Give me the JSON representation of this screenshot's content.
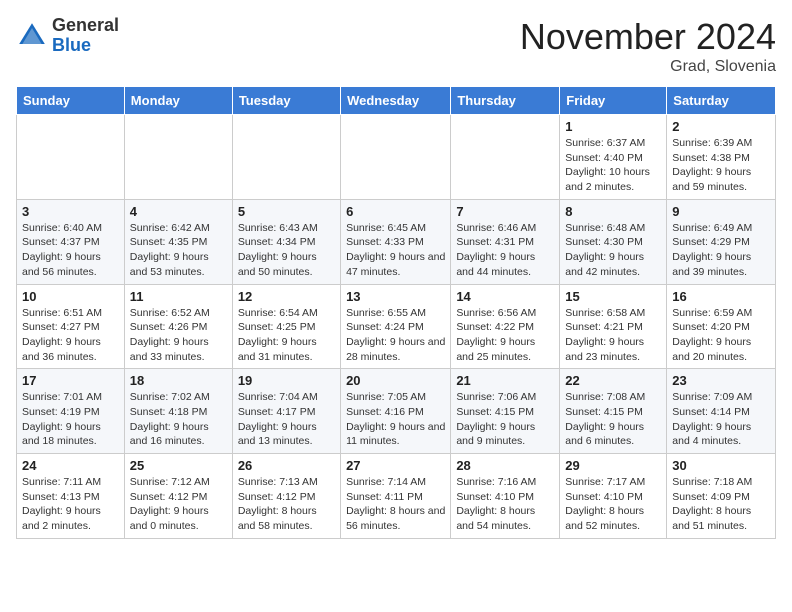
{
  "logo": {
    "general": "General",
    "blue": "Blue"
  },
  "title": "November 2024",
  "location": "Grad, Slovenia",
  "days_header": [
    "Sunday",
    "Monday",
    "Tuesday",
    "Wednesday",
    "Thursday",
    "Friday",
    "Saturday"
  ],
  "weeks": [
    [
      {
        "day": "",
        "info": ""
      },
      {
        "day": "",
        "info": ""
      },
      {
        "day": "",
        "info": ""
      },
      {
        "day": "",
        "info": ""
      },
      {
        "day": "",
        "info": ""
      },
      {
        "day": "1",
        "info": "Sunrise: 6:37 AM\nSunset: 4:40 PM\nDaylight: 10 hours and 2 minutes."
      },
      {
        "day": "2",
        "info": "Sunrise: 6:39 AM\nSunset: 4:38 PM\nDaylight: 9 hours and 59 minutes."
      }
    ],
    [
      {
        "day": "3",
        "info": "Sunrise: 6:40 AM\nSunset: 4:37 PM\nDaylight: 9 hours and 56 minutes."
      },
      {
        "day": "4",
        "info": "Sunrise: 6:42 AM\nSunset: 4:35 PM\nDaylight: 9 hours and 53 minutes."
      },
      {
        "day": "5",
        "info": "Sunrise: 6:43 AM\nSunset: 4:34 PM\nDaylight: 9 hours and 50 minutes."
      },
      {
        "day": "6",
        "info": "Sunrise: 6:45 AM\nSunset: 4:33 PM\nDaylight: 9 hours and 47 minutes."
      },
      {
        "day": "7",
        "info": "Sunrise: 6:46 AM\nSunset: 4:31 PM\nDaylight: 9 hours and 44 minutes."
      },
      {
        "day": "8",
        "info": "Sunrise: 6:48 AM\nSunset: 4:30 PM\nDaylight: 9 hours and 42 minutes."
      },
      {
        "day": "9",
        "info": "Sunrise: 6:49 AM\nSunset: 4:29 PM\nDaylight: 9 hours and 39 minutes."
      }
    ],
    [
      {
        "day": "10",
        "info": "Sunrise: 6:51 AM\nSunset: 4:27 PM\nDaylight: 9 hours and 36 minutes."
      },
      {
        "day": "11",
        "info": "Sunrise: 6:52 AM\nSunset: 4:26 PM\nDaylight: 9 hours and 33 minutes."
      },
      {
        "day": "12",
        "info": "Sunrise: 6:54 AM\nSunset: 4:25 PM\nDaylight: 9 hours and 31 minutes."
      },
      {
        "day": "13",
        "info": "Sunrise: 6:55 AM\nSunset: 4:24 PM\nDaylight: 9 hours and 28 minutes."
      },
      {
        "day": "14",
        "info": "Sunrise: 6:56 AM\nSunset: 4:22 PM\nDaylight: 9 hours and 25 minutes."
      },
      {
        "day": "15",
        "info": "Sunrise: 6:58 AM\nSunset: 4:21 PM\nDaylight: 9 hours and 23 minutes."
      },
      {
        "day": "16",
        "info": "Sunrise: 6:59 AM\nSunset: 4:20 PM\nDaylight: 9 hours and 20 minutes."
      }
    ],
    [
      {
        "day": "17",
        "info": "Sunrise: 7:01 AM\nSunset: 4:19 PM\nDaylight: 9 hours and 18 minutes."
      },
      {
        "day": "18",
        "info": "Sunrise: 7:02 AM\nSunset: 4:18 PM\nDaylight: 9 hours and 16 minutes."
      },
      {
        "day": "19",
        "info": "Sunrise: 7:04 AM\nSunset: 4:17 PM\nDaylight: 9 hours and 13 minutes."
      },
      {
        "day": "20",
        "info": "Sunrise: 7:05 AM\nSunset: 4:16 PM\nDaylight: 9 hours and 11 minutes."
      },
      {
        "day": "21",
        "info": "Sunrise: 7:06 AM\nSunset: 4:15 PM\nDaylight: 9 hours and 9 minutes."
      },
      {
        "day": "22",
        "info": "Sunrise: 7:08 AM\nSunset: 4:15 PM\nDaylight: 9 hours and 6 minutes."
      },
      {
        "day": "23",
        "info": "Sunrise: 7:09 AM\nSunset: 4:14 PM\nDaylight: 9 hours and 4 minutes."
      }
    ],
    [
      {
        "day": "24",
        "info": "Sunrise: 7:11 AM\nSunset: 4:13 PM\nDaylight: 9 hours and 2 minutes."
      },
      {
        "day": "25",
        "info": "Sunrise: 7:12 AM\nSunset: 4:12 PM\nDaylight: 9 hours and 0 minutes."
      },
      {
        "day": "26",
        "info": "Sunrise: 7:13 AM\nSunset: 4:12 PM\nDaylight: 8 hours and 58 minutes."
      },
      {
        "day": "27",
        "info": "Sunrise: 7:14 AM\nSunset: 4:11 PM\nDaylight: 8 hours and 56 minutes."
      },
      {
        "day": "28",
        "info": "Sunrise: 7:16 AM\nSunset: 4:10 PM\nDaylight: 8 hours and 54 minutes."
      },
      {
        "day": "29",
        "info": "Sunrise: 7:17 AM\nSunset: 4:10 PM\nDaylight: 8 hours and 52 minutes."
      },
      {
        "day": "30",
        "info": "Sunrise: 7:18 AM\nSunset: 4:09 PM\nDaylight: 8 hours and 51 minutes."
      }
    ]
  ]
}
